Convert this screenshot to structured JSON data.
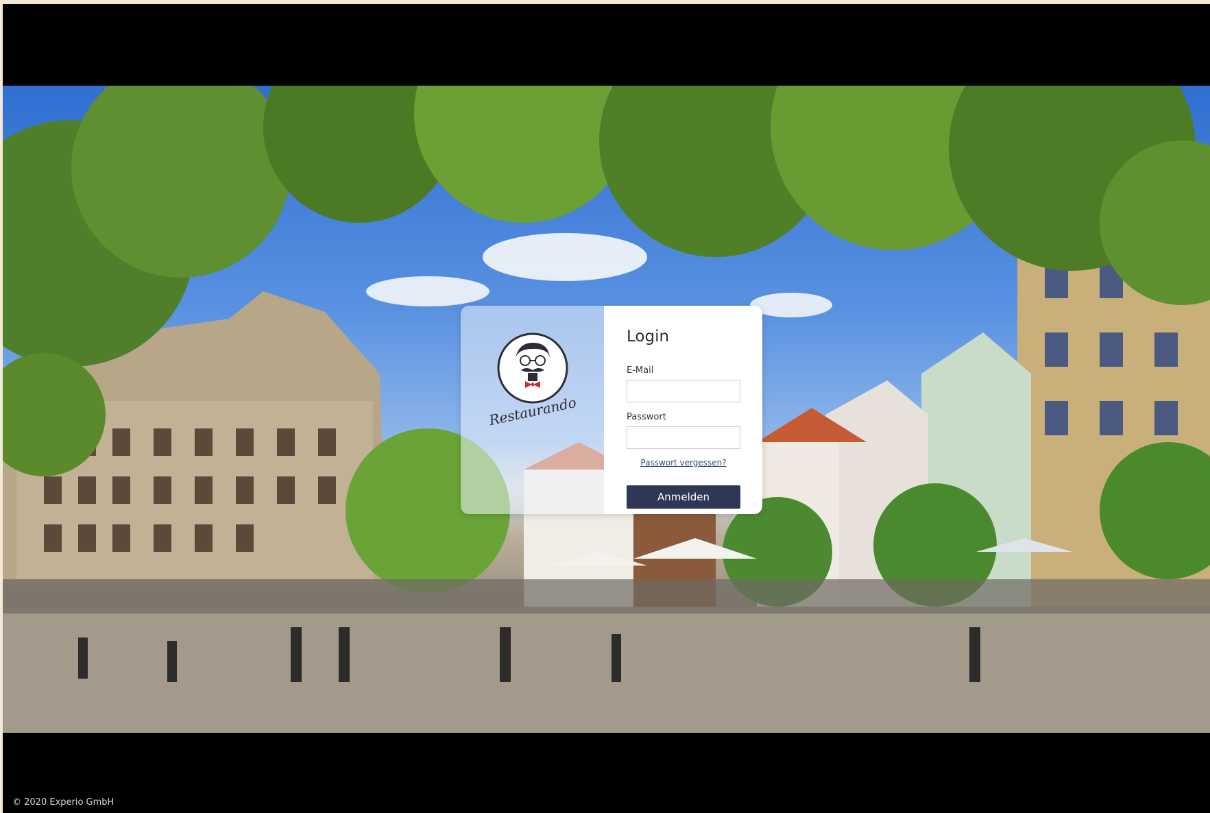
{
  "login": {
    "title": "Login",
    "email_label": "E-Mail",
    "email_value": "",
    "password_label": "Passwort",
    "password_value": "",
    "forgot_link": "Passwort vergessen?",
    "submit_label": "Anmelden"
  },
  "logo": {
    "brand_text": "Restaurando",
    "icon": "mustache-man-logo"
  },
  "footer": {
    "copyright": "© 2020 Experio GmbH"
  },
  "background": {
    "description_icon": "town-square-photo"
  },
  "colors": {
    "button": "#2f3656",
    "link": "#3a4a78",
    "bowtie": "#d42a2a"
  }
}
